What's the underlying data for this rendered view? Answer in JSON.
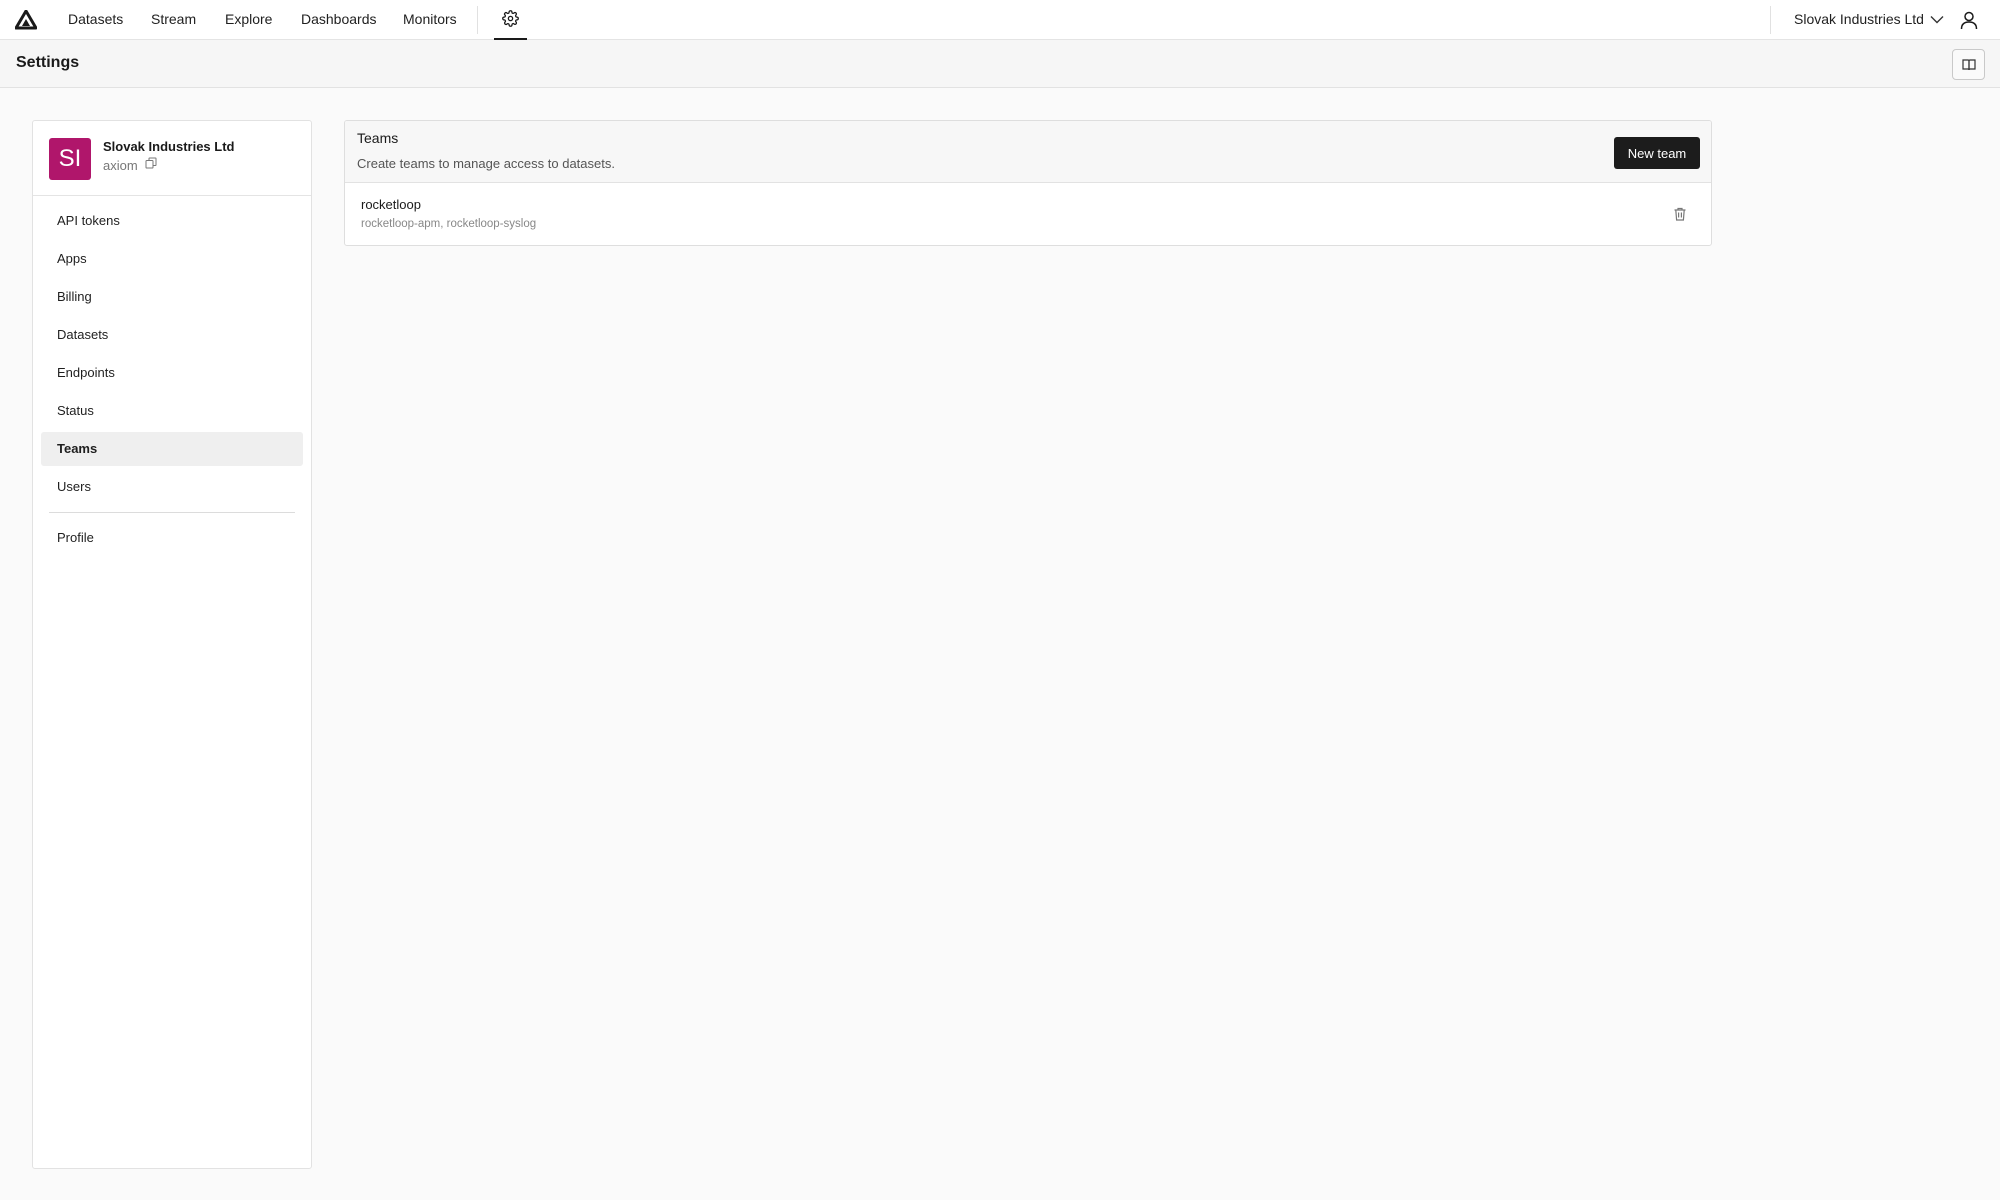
{
  "nav": {
    "items": [
      {
        "label": "Datasets"
      },
      {
        "label": "Stream"
      },
      {
        "label": "Explore"
      },
      {
        "label": "Dashboards"
      },
      {
        "label": "Monitors"
      }
    ],
    "org_switcher_label": "Slovak Industries Ltd",
    "settings_icon": "gear-icon",
    "user_icon": "user-icon"
  },
  "header": {
    "title": "Settings",
    "docs_icon": "book-icon"
  },
  "org": {
    "initials": "SI",
    "name": "Slovak Industries Ltd",
    "slug": "axiom",
    "avatar_color": "#b0166b"
  },
  "sidebar": {
    "items": [
      {
        "label": "API tokens"
      },
      {
        "label": "Apps"
      },
      {
        "label": "Billing"
      },
      {
        "label": "Datasets"
      },
      {
        "label": "Endpoints"
      },
      {
        "label": "Status"
      },
      {
        "label": "Teams",
        "active": true
      },
      {
        "label": "Users"
      }
    ],
    "footer_items": [
      {
        "label": "Profile"
      }
    ]
  },
  "teams": {
    "title": "Teams",
    "description": "Create teams to manage access to datasets.",
    "new_button_label": "New team",
    "rows": [
      {
        "name": "rocketloop",
        "datasets": "rocketloop-apm, rocketloop-syslog"
      }
    ]
  }
}
